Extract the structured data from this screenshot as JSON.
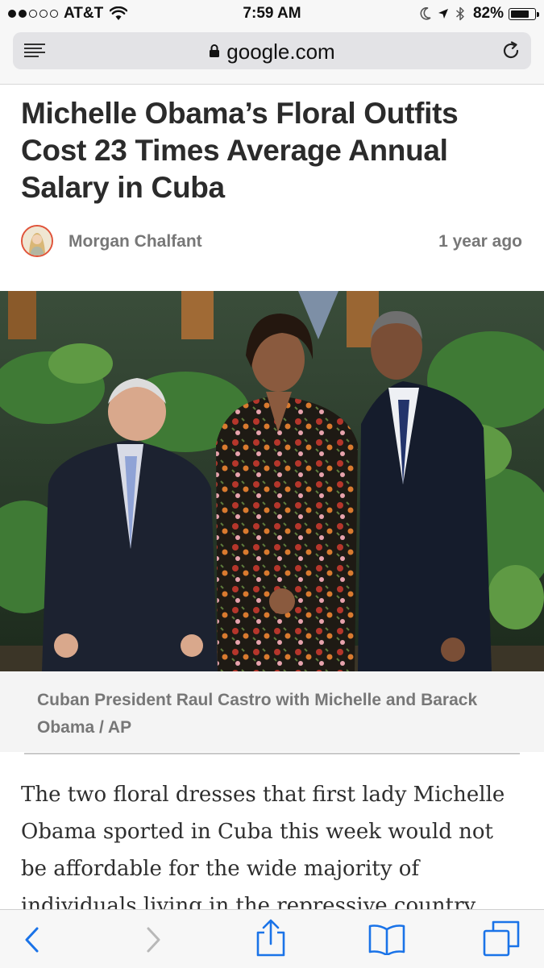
{
  "status_bar": {
    "carrier": "AT&T",
    "signal_bars": 2,
    "time": "7:59 AM",
    "battery_percent": "82%",
    "battery_level": 0.82,
    "icons": [
      "signal-dots-icon",
      "wifi-icon",
      "moon-icon",
      "location-arrow-icon",
      "bluetooth-icon",
      "battery-icon"
    ]
  },
  "browser": {
    "url": "google.com",
    "icons": [
      "reader-view-icon",
      "lock-icon",
      "reload-icon"
    ]
  },
  "article": {
    "headline": "Michelle Obama’s Floral Outfits Cost 23 Times Average Annual Salary in Cuba",
    "author": "Morgan Chalfant",
    "time_ago": "1 year ago",
    "caption": "Cuban President Raul Castro with Michelle and Barack Obama / AP",
    "body": "The two floral dresses that first lady Michelle Obama sported in Cuba this week would not be affordable for the wide majority of individuals living in the repressive country."
  },
  "toolbar": {
    "icons": [
      "back-icon",
      "forward-icon",
      "share-icon",
      "bookmarks-icon",
      "tabs-icon"
    ]
  },
  "colors": {
    "accent": "#1a73e8",
    "avatar_border": "#e0533a",
    "headline": "#2b2b2b",
    "meta": "#777777"
  }
}
